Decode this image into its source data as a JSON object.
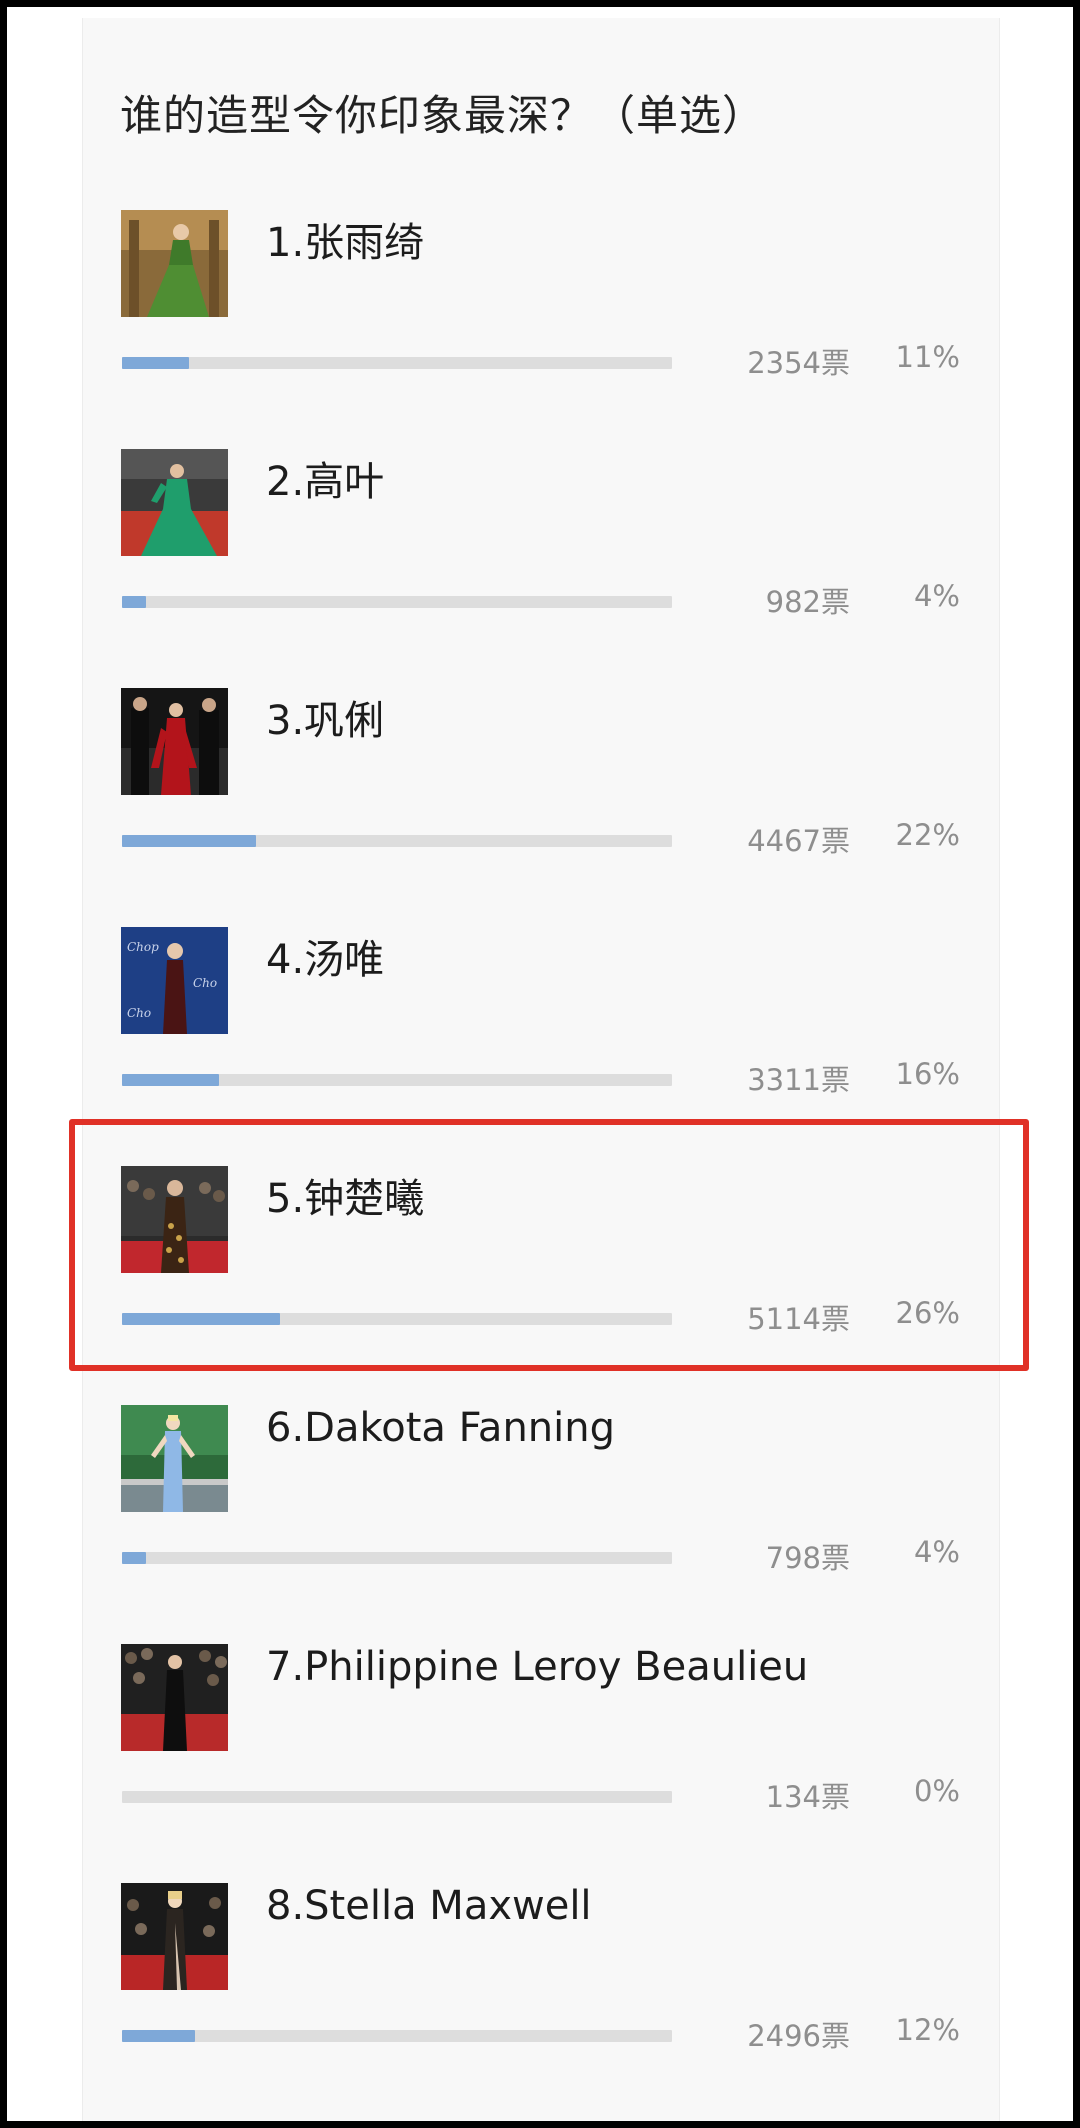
{
  "poll": {
    "title": "谁的造型令你印象最深？（单选）",
    "bar_color": "#7ea8d8",
    "highlight_color": "#e03127",
    "options": [
      {
        "label": "1.张雨绮",
        "votes": "2354票",
        "percent": "11%",
        "share": 0.11,
        "thumb_icon": "photo-green-gown-icon"
      },
      {
        "label": "2.高叶",
        "votes": "982票",
        "percent": "4%",
        "share": 0.04,
        "thumb_icon": "photo-teal-gown-red-carpet-icon"
      },
      {
        "label": "3.巩俐",
        "votes": "4467票",
        "percent": "22%",
        "share": 0.22,
        "thumb_icon": "photo-red-dress-icon"
      },
      {
        "label": "4.汤唯",
        "votes": "3311票",
        "percent": "16%",
        "share": 0.16,
        "thumb_icon": "photo-dark-gown-blue-backdrop-icon"
      },
      {
        "label": "5.钟楚曦",
        "votes": "5114票",
        "percent": "26%",
        "share": 0.26,
        "thumb_icon": "photo-patterned-gown-red-carpet-icon",
        "highlighted": true
      },
      {
        "label": "6.Dakota Fanning",
        "votes": "798票",
        "percent": "4%",
        "share": 0.04,
        "thumb_icon": "photo-blue-dress-balcony-icon"
      },
      {
        "label": "7.Philippine Leroy Beaulieu",
        "votes": "134票",
        "percent": "0%",
        "share": 0.0,
        "thumb_icon": "photo-black-gown-red-carpet-icon"
      },
      {
        "label": "8.Stella Maxwell",
        "votes": "2496票",
        "percent": "12%",
        "share": 0.12,
        "thumb_icon": "photo-sheer-gown-red-carpet-icon"
      }
    ]
  }
}
